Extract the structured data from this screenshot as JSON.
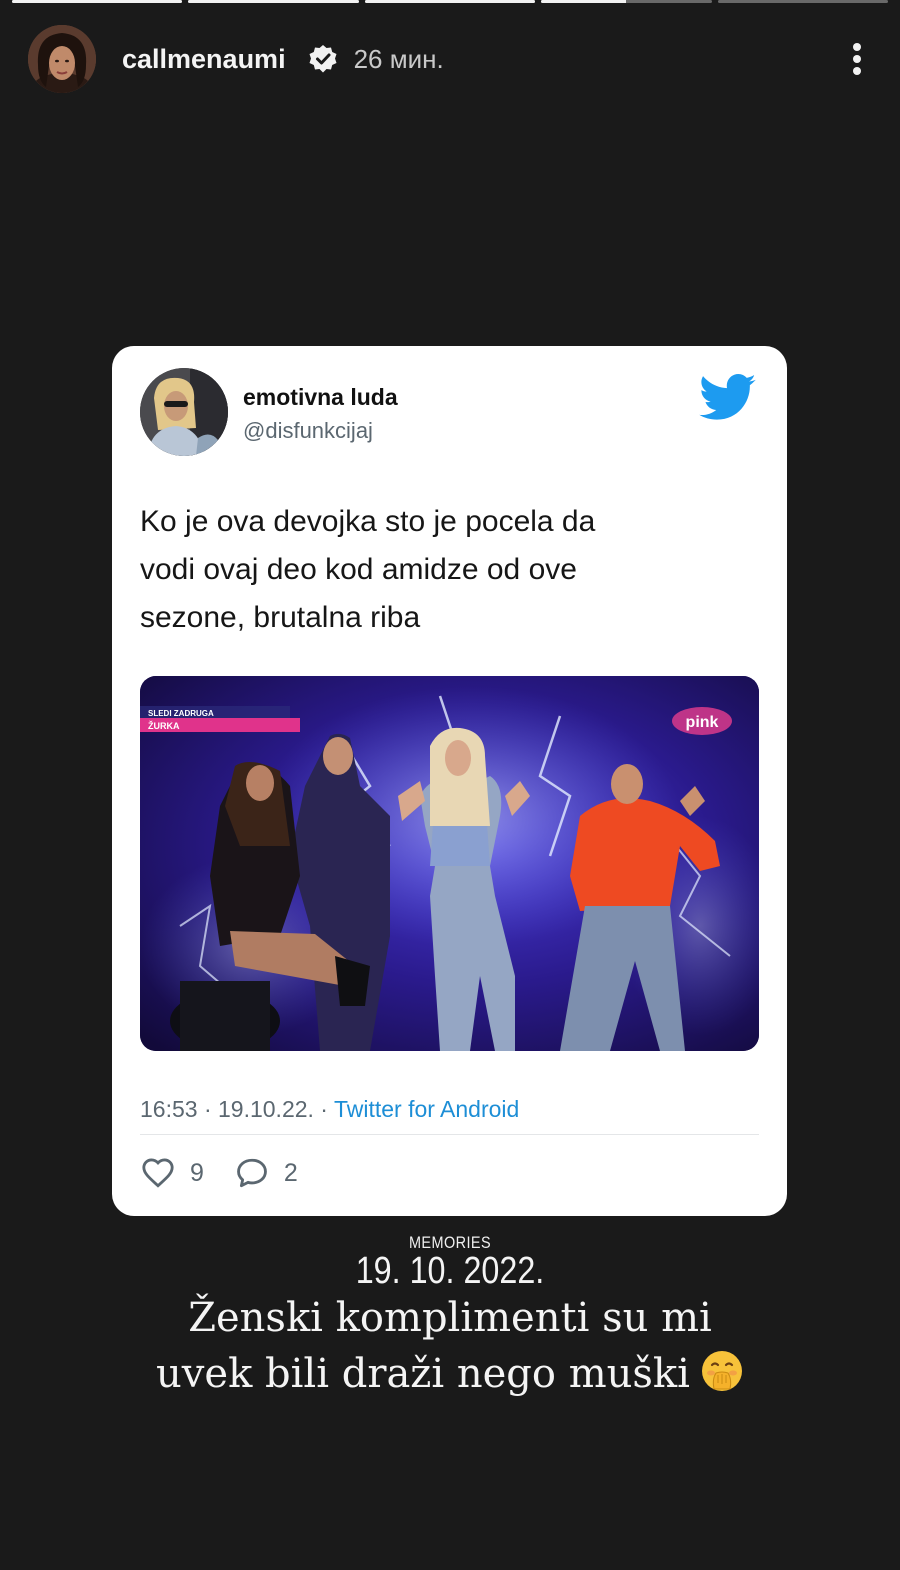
{
  "story": {
    "progress": [
      1,
      1,
      1,
      0.5,
      0
    ]
  },
  "header": {
    "username": "callmenaumi",
    "time": "26 мин."
  },
  "tweet": {
    "name": "emotivna luda",
    "handle": "@disfunkcijaj",
    "text_lines": [
      "Ko je ova devojka sto je pocela da",
      "vodi ovaj deo kod amidze od ove",
      "sezone, brutalna riba"
    ],
    "meta_time": "16:53 · 19.10.22. · ",
    "meta_source": "Twitter for Android",
    "likes": "9",
    "replies": "2",
    "media": {
      "overlay_top": "SLEDI ZADRUGA",
      "overlay_bottom": "ŽURKA",
      "channel_logo": "pink"
    }
  },
  "memories": {
    "label": "MEMORIES",
    "date": "19. 10. 2022."
  },
  "caption": {
    "line1": "Ženski komplimenti su mi",
    "line2": "uvek bili draži nego muški"
  },
  "colors": {
    "background": "#1a1a1a",
    "twitter_blue": "#1d9bf0",
    "link_blue": "#1d8ed6"
  },
  "icons": [
    "verified-icon",
    "more-icon",
    "twitter-bird-icon",
    "heart-icon",
    "reply-icon",
    "hand-over-mouth-emoji"
  ]
}
